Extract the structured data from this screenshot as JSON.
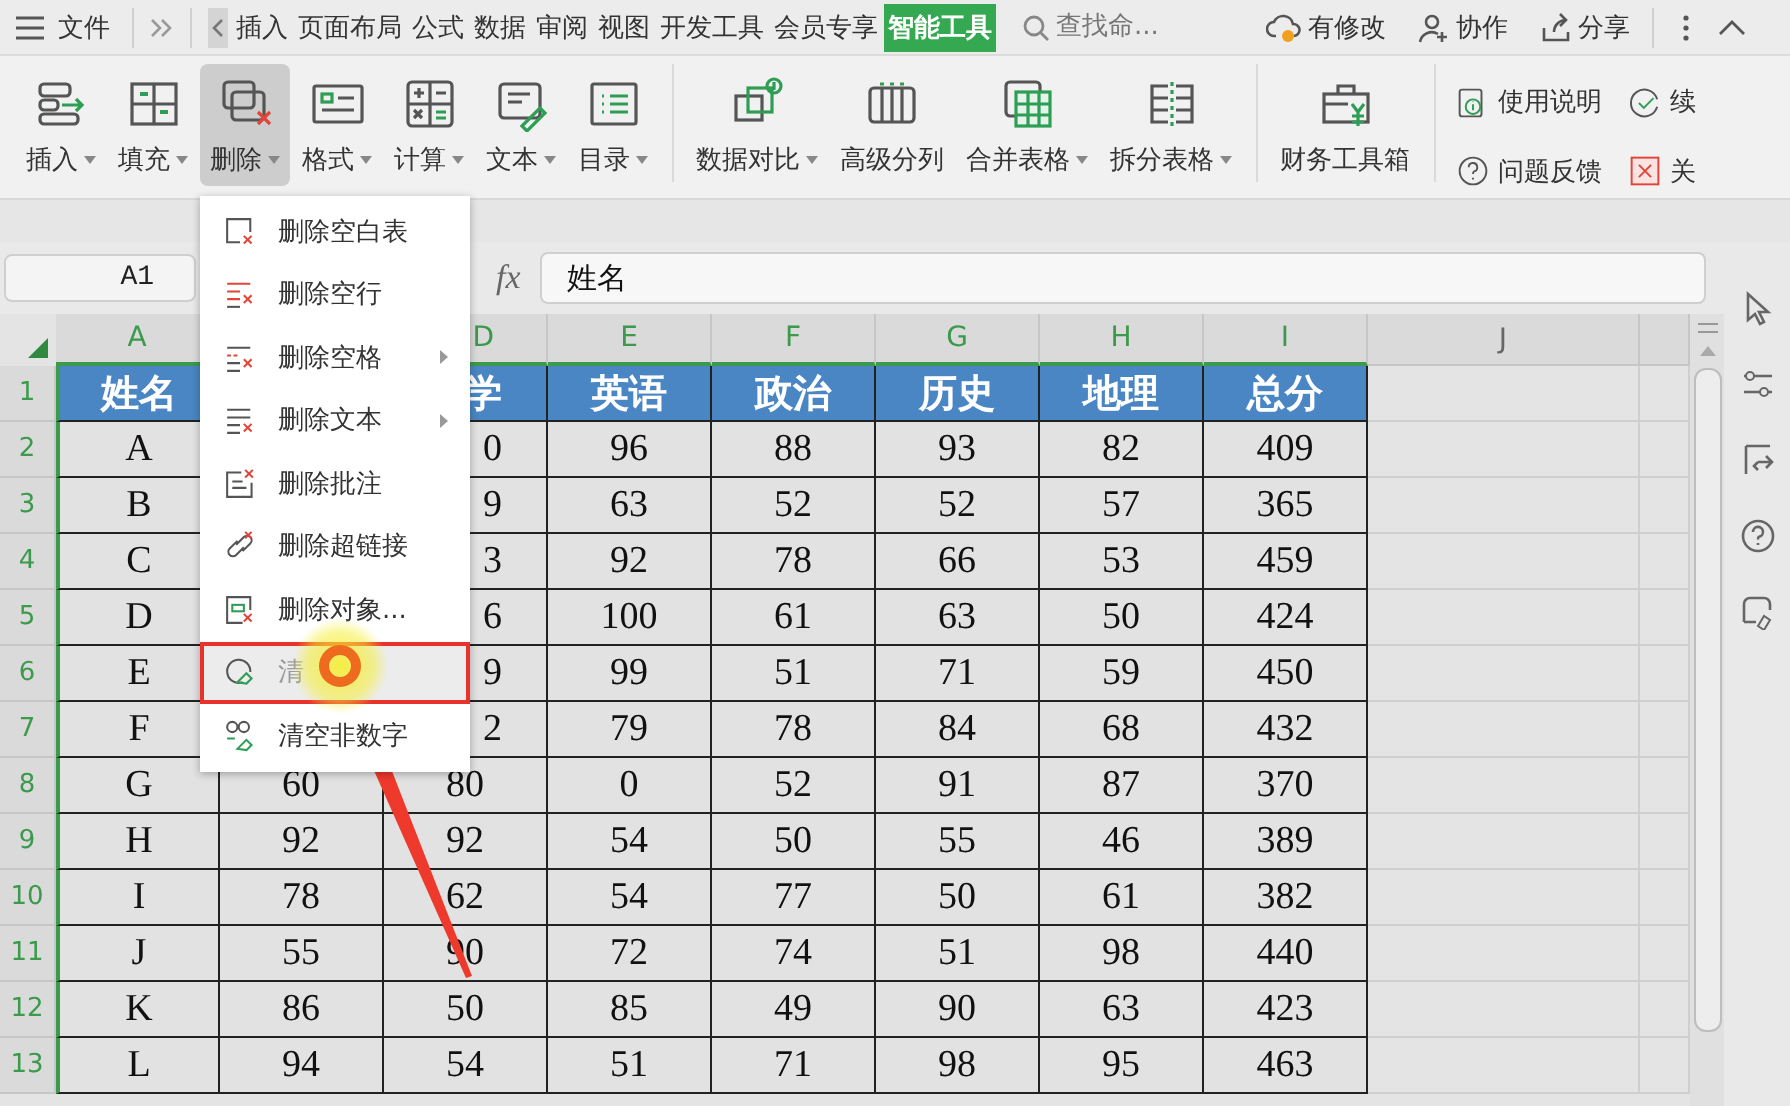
{
  "title_bar": {
    "file_menu": "文件",
    "tabs": [
      {
        "label": "插入",
        "selected": false
      },
      {
        "label": "页面布局",
        "selected": false
      },
      {
        "label": "公式",
        "selected": false
      },
      {
        "label": "数据",
        "selected": false
      },
      {
        "label": "审阅",
        "selected": false
      },
      {
        "label": "视图",
        "selected": false
      },
      {
        "label": "开发工具",
        "selected": false
      },
      {
        "label": "会员专享",
        "selected": false
      },
      {
        "label": "智能工具",
        "selected": true
      }
    ],
    "search": {
      "placeholder": "查找命..."
    },
    "actions": [
      "有修改",
      "协作",
      "分享"
    ]
  },
  "ribbon": {
    "groups": [
      {
        "buttons": [
          {
            "label": "插入",
            "dropdown": true,
            "pressed": false
          },
          {
            "label": "填充",
            "dropdown": true,
            "pressed": false
          },
          {
            "label": "删除",
            "dropdown": true,
            "pressed": true
          },
          {
            "label": "格式",
            "dropdown": true,
            "pressed": false
          },
          {
            "label": "计算",
            "dropdown": true,
            "pressed": false
          },
          {
            "label": "文本",
            "dropdown": true,
            "pressed": false
          },
          {
            "label": "目录",
            "dropdown": true,
            "pressed": false
          }
        ]
      },
      {
        "buttons": [
          {
            "label": "数据对比",
            "dropdown": true,
            "pressed": false
          },
          {
            "label": "高级分列",
            "dropdown": false,
            "pressed": false
          },
          {
            "label": "合并表格",
            "dropdown": true,
            "pressed": false
          },
          {
            "label": "拆分表格",
            "dropdown": true,
            "pressed": false
          }
        ]
      },
      {
        "buttons": [
          {
            "label": "财务工具箱",
            "dropdown": false,
            "pressed": false
          }
        ]
      }
    ],
    "side_buttons": [
      "使用说明",
      "问题反馈",
      "续",
      "关"
    ]
  },
  "formula_bar": {
    "cell": "A1",
    "function_label": "fx",
    "value": "姓名"
  },
  "sheet": {
    "columns": [
      {
        "label": "A",
        "selected": true
      },
      null,
      {
        "label": "D",
        "selected": true
      },
      {
        "label": "E",
        "selected": true
      },
      {
        "label": "F",
        "selected": true
      },
      {
        "label": "G",
        "selected": true
      },
      {
        "label": "H",
        "selected": true
      },
      {
        "label": "I",
        "selected": true
      },
      {
        "label": "J",
        "selected": false
      }
    ],
    "rows": [
      {
        "number": "1",
        "selected": true,
        "kind": "header",
        "cells": [
          "姓名",
          null,
          "学",
          "英语",
          "政治",
          "历史",
          "地理",
          "总分"
        ]
      },
      {
        "number": "2",
        "selected": true,
        "kind": "data",
        "cells": [
          "A",
          null,
          "0",
          "96",
          "88",
          "93",
          "82",
          "409"
        ]
      },
      {
        "number": "3",
        "selected": true,
        "kind": "data",
        "cells": [
          "B",
          null,
          "9",
          "63",
          "52",
          "52",
          "57",
          "365"
        ]
      },
      {
        "number": "4",
        "selected": true,
        "kind": "data",
        "cells": [
          "C",
          null,
          "3",
          "92",
          "78",
          "66",
          "53",
          "459"
        ]
      },
      {
        "number": "5",
        "selected": true,
        "kind": "data",
        "cells": [
          "D",
          null,
          "6",
          "100",
          "61",
          "63",
          "50",
          "424"
        ]
      },
      {
        "number": "6",
        "selected": true,
        "kind": "data",
        "cells": [
          "E",
          null,
          "9",
          "99",
          "51",
          "71",
          "59",
          "450"
        ]
      },
      {
        "number": "7",
        "selected": true,
        "kind": "data",
        "cells": [
          "F",
          null,
          "2",
          "79",
          "78",
          "84",
          "68",
          "432"
        ]
      },
      {
        "number": "8",
        "selected": true,
        "kind": "data",
        "cells": [
          "G",
          "60",
          "80",
          "0",
          "52",
          "91",
          "87",
          "370"
        ]
      },
      {
        "number": "9",
        "selected": true,
        "kind": "data",
        "cells": [
          "H",
          "92",
          "92",
          "54",
          "50",
          "55",
          "46",
          "389"
        ]
      },
      {
        "number": "10",
        "selected": true,
        "kind": "data",
        "cells": [
          "I",
          "78",
          "62",
          "54",
          "77",
          "50",
          "61",
          "382"
        ]
      },
      {
        "number": "11",
        "selected": true,
        "kind": "data",
        "cells": [
          "J",
          "55",
          "90",
          "72",
          "74",
          "51",
          "98",
          "440"
        ]
      },
      {
        "number": "12",
        "selected": true,
        "kind": "data",
        "cells": [
          "K",
          "86",
          "50",
          "85",
          "49",
          "90",
          "63",
          "423"
        ]
      },
      {
        "number": "13",
        "selected": true,
        "kind": "data",
        "cells": [
          "L",
          "94",
          "54",
          "51",
          "71",
          "98",
          "95",
          "463"
        ]
      }
    ]
  },
  "context_menu": {
    "items": [
      {
        "label": "删除空白表",
        "submenu": false,
        "selected": false
      },
      {
        "label": "删除空行",
        "submenu": false,
        "selected": false
      },
      {
        "label": "删除空格",
        "submenu": true,
        "selected": false
      },
      {
        "label": "删除文本",
        "submenu": true,
        "selected": false
      },
      {
        "label": "删除批注",
        "submenu": false,
        "selected": false
      },
      {
        "label": "删除超链接",
        "submenu": false,
        "selected": false
      },
      {
        "label": "删除对象...",
        "submenu": false,
        "selected": false
      },
      {
        "label": "清",
        "submenu": false,
        "selected": true
      },
      {
        "label": "清空非数字",
        "submenu": false,
        "selected": false
      }
    ]
  }
}
